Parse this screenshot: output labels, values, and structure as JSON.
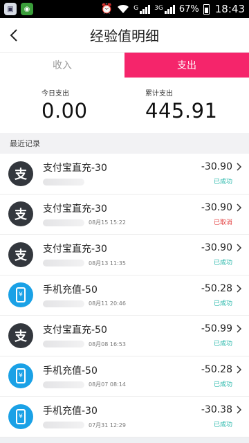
{
  "status_bar": {
    "net_label": "G",
    "net_label_2": "3G",
    "battery": "67%",
    "time": "18:43",
    "icons": [
      "app-icon",
      "wechat-icon",
      "alarm-icon",
      "wifi-icon",
      "signal-icon",
      "battery-icon"
    ]
  },
  "header": {
    "title": "经验值明细",
    "back_icon": "chevron-left-icon"
  },
  "tabs": [
    {
      "label": "收入",
      "active": false
    },
    {
      "label": "支出",
      "active": true
    }
  ],
  "summary": {
    "today_label": "今日支出",
    "today_value": "0.00",
    "total_label": "累计支出",
    "total_value": "445.91"
  },
  "section_label": "最近记录",
  "records": [
    {
      "icon": "alipay-icon",
      "icon_glyph": "支",
      "title": "支付宝直充-30",
      "date": "",
      "amount": "-30.90",
      "status": "已成功",
      "status_color": "#22b6a8"
    },
    {
      "icon": "alipay-icon",
      "icon_glyph": "支",
      "title": "支付宝直充-30",
      "date": "08月15 15:22",
      "amount": "-30.90",
      "status": "已取消",
      "status_color": "#e23b3b"
    },
    {
      "icon": "alipay-icon",
      "icon_glyph": "支",
      "title": "支付宝直充-30",
      "date": "08月13 11:35",
      "amount": "-30.90",
      "status": "已成功",
      "status_color": "#22b6a8"
    },
    {
      "icon": "phone-topup-icon",
      "icon_glyph": "¥",
      "title": "手机充值-50",
      "date": "08月11 20:46",
      "amount": "-50.28",
      "status": "已成功",
      "status_color": "#22b6a8"
    },
    {
      "icon": "alipay-icon",
      "icon_glyph": "支",
      "title": "支付宝直充-50",
      "date": "08月08 16:53",
      "amount": "-50.99",
      "status": "已成功",
      "status_color": "#22b6a8"
    },
    {
      "icon": "phone-topup-icon",
      "icon_glyph": "¥",
      "title": "手机充值-50",
      "date": "08月07 08:14",
      "amount": "-50.28",
      "status": "已成功",
      "status_color": "#22b6a8"
    },
    {
      "icon": "phone-topup-icon",
      "icon_glyph": "¥",
      "title": "手机充值-30",
      "date": "07月31 12:29",
      "amount": "-30.38",
      "status": "已成功",
      "status_color": "#22b6a8"
    }
  ],
  "colors": {
    "accent": "#f5256b",
    "success": "#22b6a8",
    "cancelled": "#e23b3b"
  }
}
